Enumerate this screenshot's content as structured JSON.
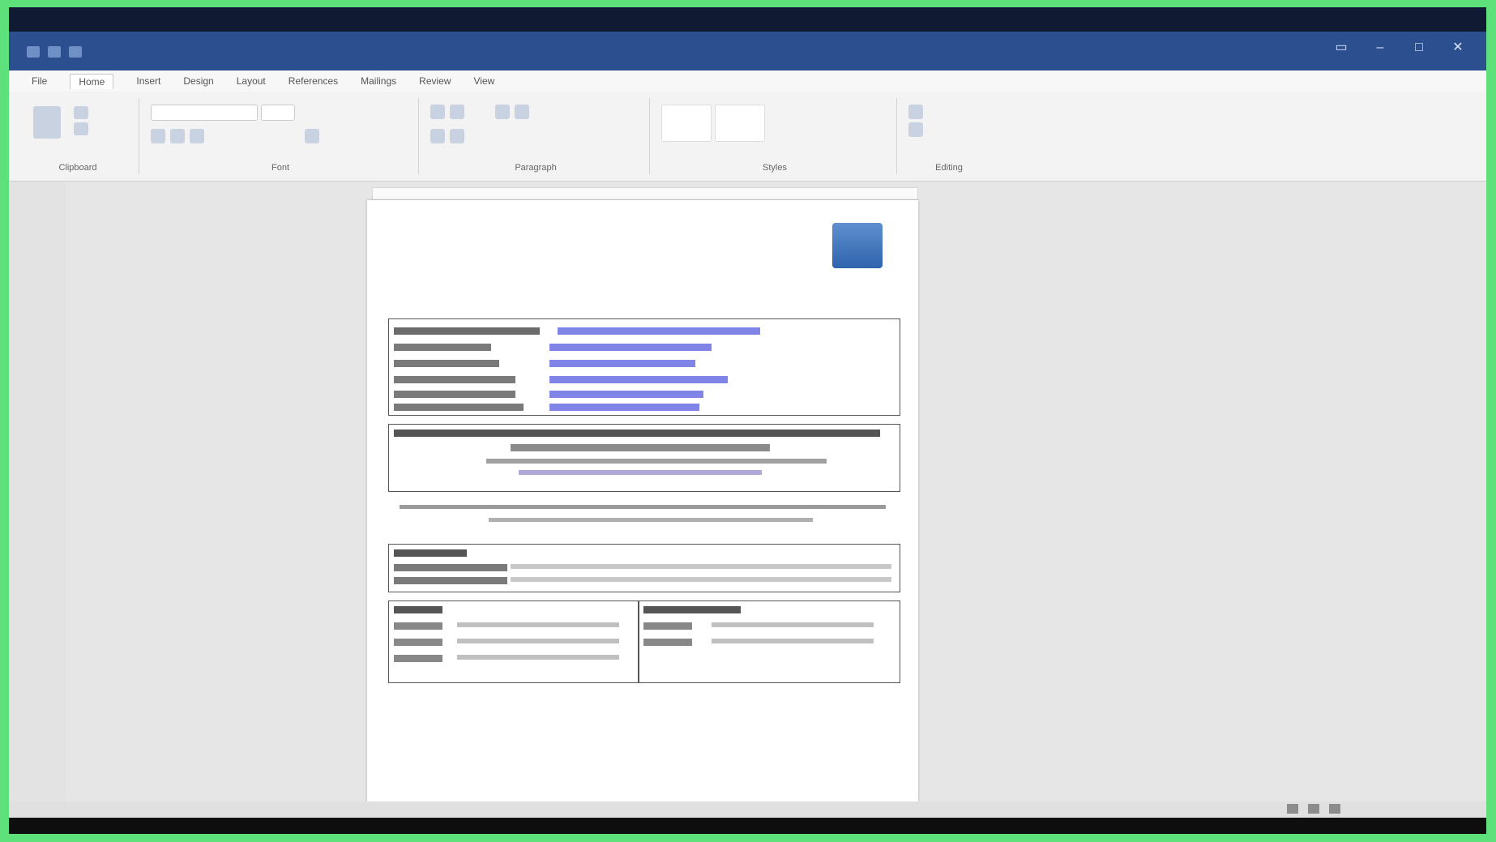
{
  "window": {
    "title": ""
  },
  "ribbon": {
    "tabs": [
      {
        "label": "File",
        "active": false
      },
      {
        "label": "Home",
        "active": true
      },
      {
        "label": "Insert",
        "active": false
      },
      {
        "label": "Design",
        "active": false
      },
      {
        "label": "Layout",
        "active": false
      },
      {
        "label": "References",
        "active": false
      },
      {
        "label": "Mailings",
        "active": false
      },
      {
        "label": "Review",
        "active": false
      },
      {
        "label": "View",
        "active": false
      }
    ],
    "group_labels": [
      "Clipboard",
      "Font",
      "Paragraph",
      "Styles",
      "Editing"
    ]
  },
  "document": {
    "title": "",
    "subtitle": "",
    "note": ""
  },
  "status": {
    "left": "",
    "zoom": ""
  },
  "colors": {
    "titlebar": "#2b4f8f",
    "highlight": "#7f84e6",
    "frame": "#5ee07a"
  }
}
